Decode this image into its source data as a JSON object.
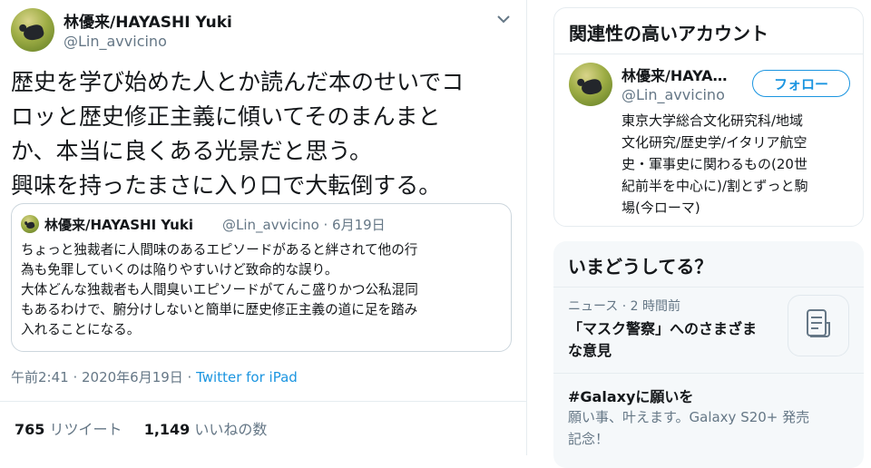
{
  "tweet": {
    "author_name": "林優来/HAYASHI Yuki",
    "author_handle": "@Lin_avvicino",
    "text_lines": [
      "歴史を学び始めた人とか読んだ本のせいでコ",
      "ロッと歴史修正主義に傾いてそのまんまと",
      "か、本当に良くある光景だと思う。",
      "興味を持ったまさに入り口で大転倒する。"
    ],
    "timestamp": "午前2:41 · 2020年6月19日 · ",
    "source": "Twitter for iPad",
    "stats": {
      "retweets_count": "765",
      "retweets_label": "リツイート",
      "likes_count": "1,149",
      "likes_label": "いいねの数"
    }
  },
  "quoted": {
    "author_name": "林優来/HAYASHI Yuki",
    "handle_date": "@Lin_avvicino · 6月19日",
    "text_lines": [
      "ちょっと独裁者に人間味のあるエピソードがあると絆されて他の行",
      "為も免罪していくのは陥りやすいけど致命的な誤り。",
      "大体どんな独裁者も人間臭いエピソードがてんこ盛りかつ公私混同",
      "もあるわけで、腑分けしないと簡単に歴史修正主義の道に足を踏み",
      "入れることになる。"
    ]
  },
  "related": {
    "heading": "関連性の高いアカウント",
    "account_name": "林優来/HAYA…",
    "account_handle": "@Lin_avvicino",
    "follow_label": "フォロー",
    "bio_lines": [
      "東京大学総合文化研究科/地域",
      "文化研究/歴史学/イタリア航空",
      "史・軍事史に関わるもの(20世",
      "紀前半を中心に)/割とずっと駒",
      "場(今ローマ)"
    ]
  },
  "trends": {
    "heading": "いまどうしてる？",
    "items": [
      {
        "meta": "ニュース · 2 時間前",
        "title_lines": [
          "「マスク警察」へのさまざま",
          "な意見"
        ]
      },
      {
        "title": "#Galaxyに願いを",
        "desc_lines": [
          "願い事、叶えます。Galaxy S20+ 発売",
          "記念！"
        ]
      }
    ]
  },
  "colors": {
    "accent": "#1b95e0",
    "secondary_text": "#657786",
    "border": "#e6ecf0",
    "panel_bg": "#f5f8fa"
  }
}
